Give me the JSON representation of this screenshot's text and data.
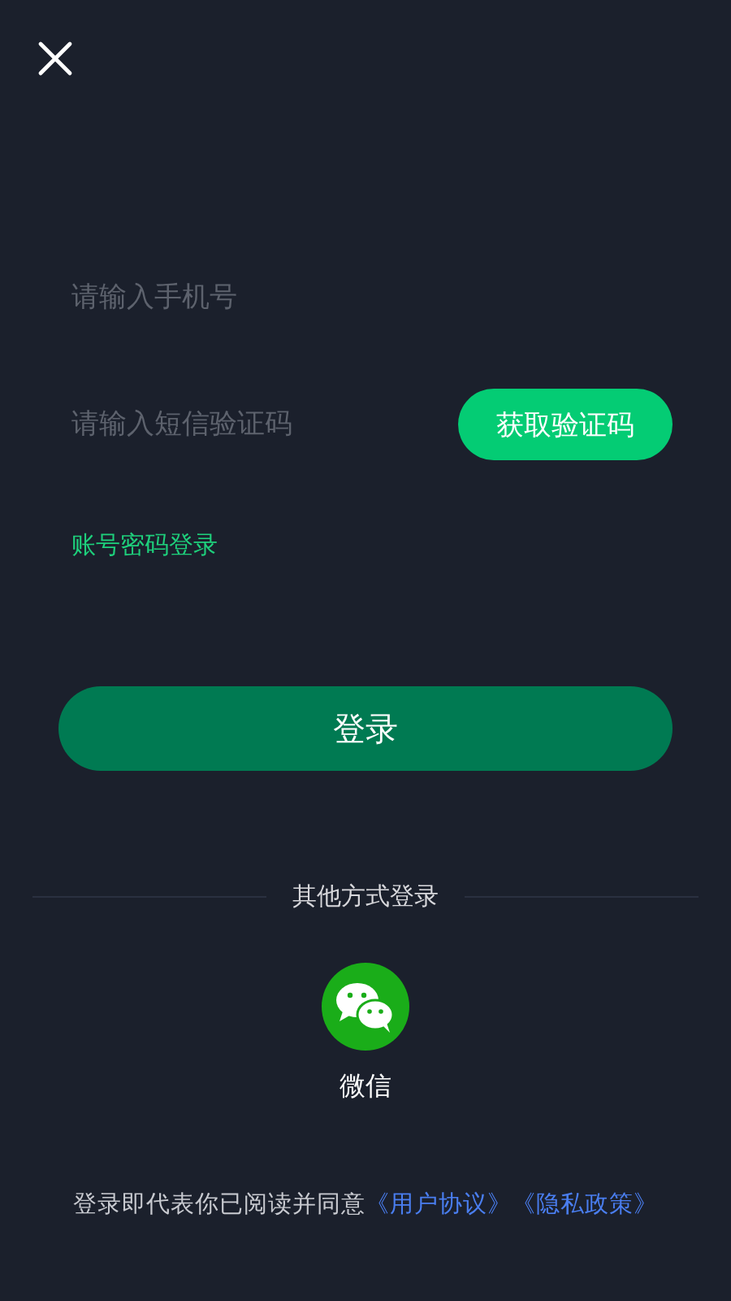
{
  "phone_field": {
    "placeholder": "请输入手机号"
  },
  "code_field": {
    "placeholder": "请输入短信验证码"
  },
  "get_code_button": "获取验证码",
  "password_login_link": "账号密码登录",
  "login_button": "登录",
  "other_methods": {
    "heading": "其他方式登录",
    "options": [
      {
        "kind": "wechat",
        "label": "微信"
      }
    ]
  },
  "agreement": {
    "text": "登录即代表你已阅读并同意",
    "links": [
      "《用户协议》",
      "《隐私政策》"
    ]
  }
}
